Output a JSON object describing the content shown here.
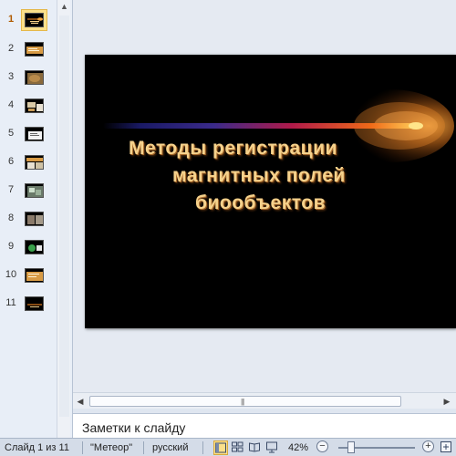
{
  "thumbnails": [
    {
      "number": "1"
    },
    {
      "number": "2"
    },
    {
      "number": "3"
    },
    {
      "number": "4"
    },
    {
      "number": "5"
    },
    {
      "number": "6"
    },
    {
      "number": "7"
    },
    {
      "number": "8"
    },
    {
      "number": "9"
    },
    {
      "number": "10"
    },
    {
      "number": "11"
    }
  ],
  "slide": {
    "title_line1": "Методы регистрации",
    "title_line2": "магнитных полей",
    "title_line3": "биообъектов"
  },
  "notes": {
    "placeholder": "Заметки к слайду"
  },
  "status": {
    "slide_counter": "Слайд 1 из 11",
    "theme": "\"Метеор\"",
    "language": "русский",
    "zoom": "42%"
  },
  "scrollbar": {
    "grip": "|||"
  },
  "colors": {
    "accent_selected": "#fbe08a",
    "title_text": "#f6d28c"
  }
}
